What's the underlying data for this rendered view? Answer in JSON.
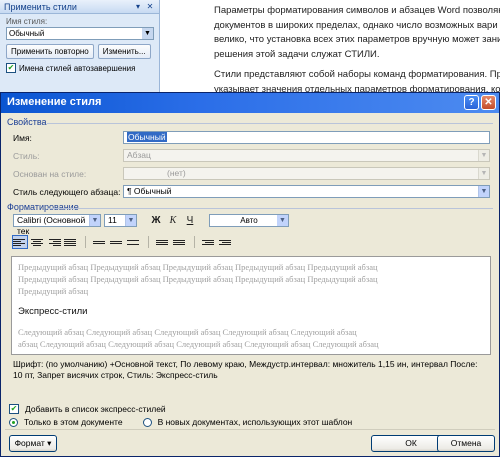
{
  "taskpane": {
    "title": "Применить стили",
    "style_name_label": "Имя стиля:",
    "style_value": "Обычный",
    "reapply_label": "Применить повторно",
    "modify_label": "Изменить...",
    "autocomplete_label": "Имена стилей автозавершения",
    "autocomplete_checked": true
  },
  "document": {
    "paragraph1": [
      "Параметры форматирования символов и абзацев Word позволяют",
      "документов в широких пределах, однако число возможных вари",
      "велико, что установка всех этих параметров вручную может заним",
      "решения этой задачи служат СТИЛИ."
    ],
    "paragraph2": [
      "Стили представляют собой наборы команд форматирования. При",
      "указывает значения отдельных параметров форматирования, кото"
    ]
  },
  "dialog": {
    "title": "Изменение стиля",
    "help_button": "?",
    "close_button": "✕",
    "properties_section": "Свойства",
    "name_label": "Имя:",
    "name_value": "Обычный",
    "style_label": "Стиль:",
    "style_value": "Абзац",
    "based_on_label": "Основан на стиле:",
    "based_on_value": "(нет)",
    "next_style_label": "Стиль следующего абзаца:",
    "next_style_value": "¶ Обычный",
    "formatting_section": "Форматирование",
    "font_value": "Calibri (Основной тек",
    "size_value": "11",
    "bold_label": "Ж",
    "italic_label": "К",
    "underline_label": "Ч",
    "color_value": "Авто",
    "preview": {
      "prev_lines": [
        "Предыдущий абзац Предыдущий абзац Предыдущий абзац Предыдущий абзац Предыдущий абзац",
        "Предыдущий абзац Предыдущий абзац Предыдущий абзац Предыдущий абзац Предыдущий абзац",
        "Предыдущий абзац"
      ],
      "sample_text": "Экспресс-стили",
      "next_lines": [
        "Следующий абзац Следующий абзац Следующий абзац Следующий абзац Следующий абзац",
        "абзац Следующий абзац Следующий абзац Следующий абзац Следующий абзац Следующий абзац"
      ]
    },
    "description": "Шрифт: (по умолчанию) +Основной текст, По левому краю, Междустр.интервал: множитель 1,15 ин, интервал После: 10 пт, Запрет висячих строк, Стиль: Экспресс-стиль",
    "add_to_quick_label": "Добавить в список экспресс-стилей",
    "add_to_quick_checked": true,
    "only_this_doc_label": "Только в этом документе",
    "new_docs_label": "В новых документах, использующих этот шаблон",
    "selected_scope": "only_this_doc",
    "format_button": "Формат",
    "ok_button": "ОК",
    "cancel_button": "Отмена"
  }
}
